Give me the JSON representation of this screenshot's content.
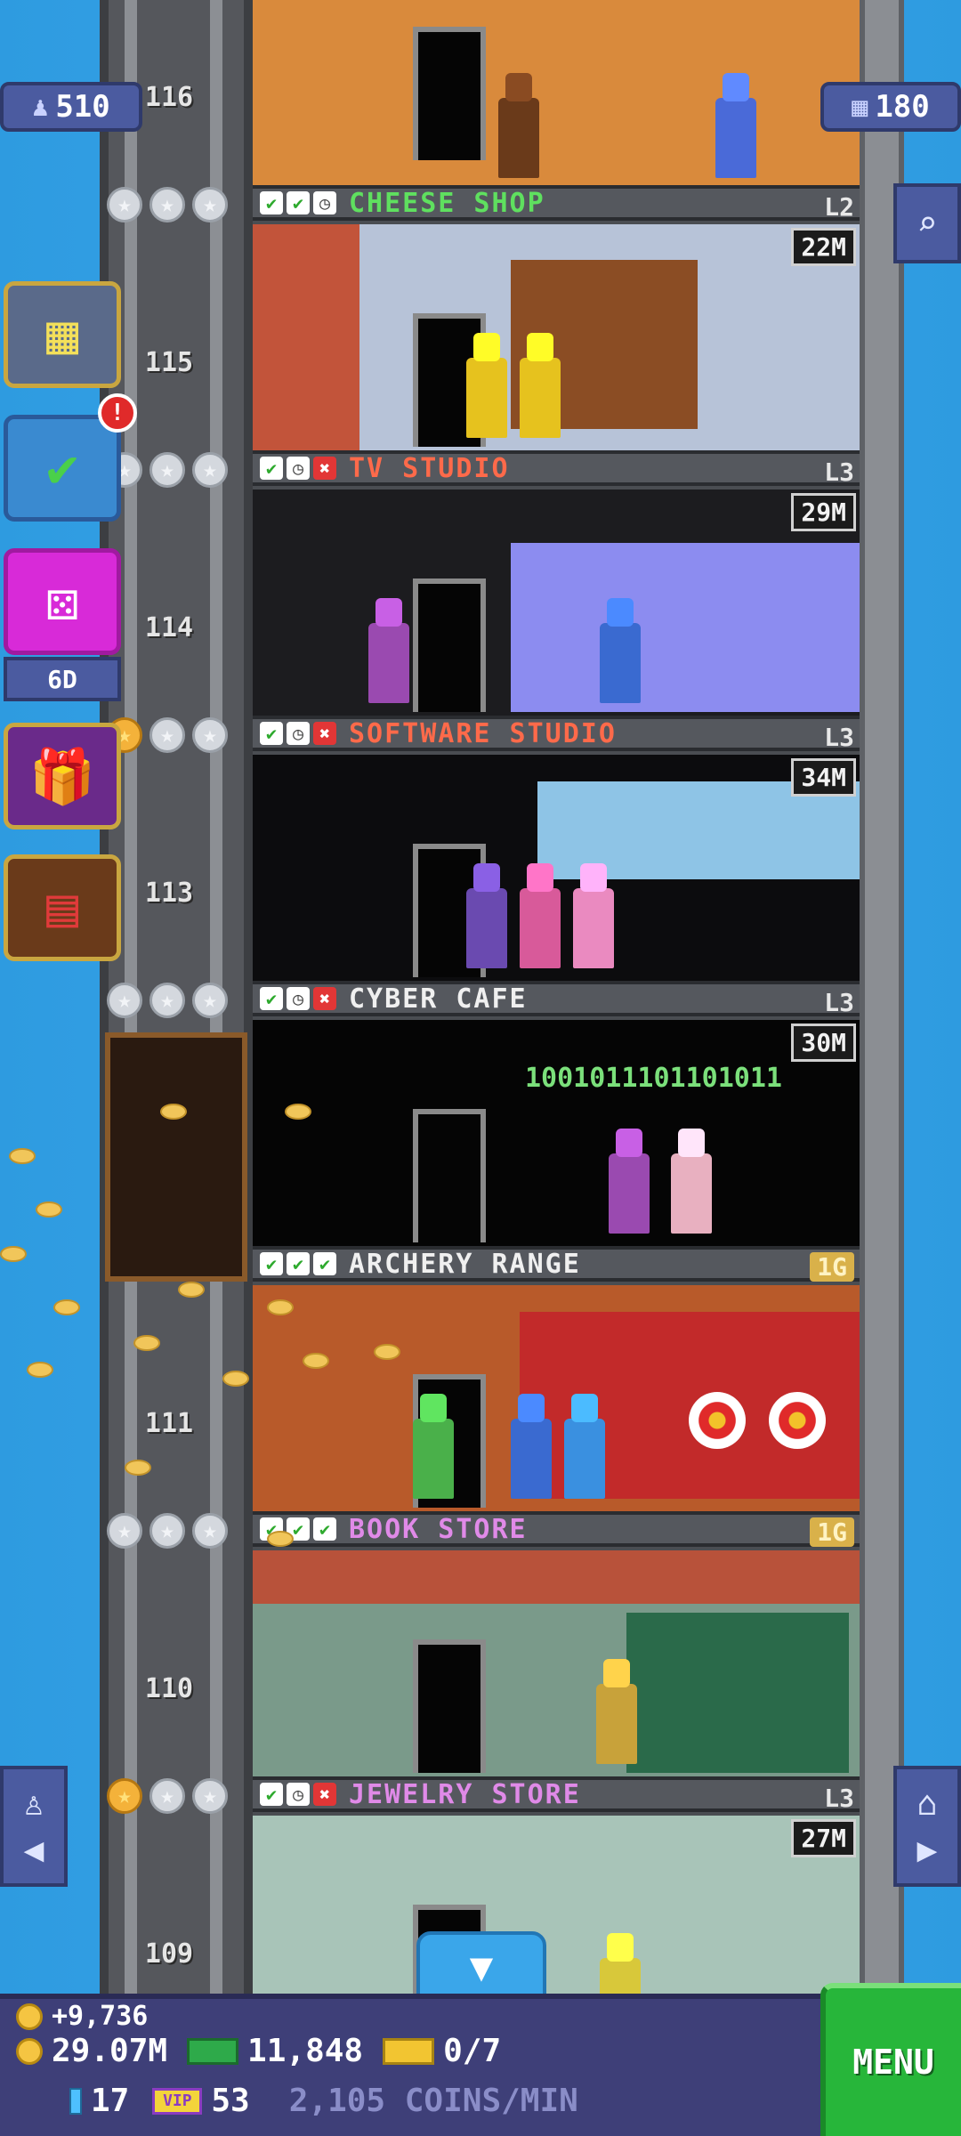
{
  "top_stats": {
    "population": "510",
    "floors_count": "180"
  },
  "side_buttons": {
    "dice_timer": "6D",
    "missions_badge": "!"
  },
  "shaft_floor_numbers": [
    "116",
    "115",
    "114",
    "113",
    "111",
    "110",
    "109"
  ],
  "floors": [
    {
      "name": "CHEESE SHOP",
      "level": "L2",
      "value": "22M",
      "name_color": "#5fe05f",
      "checks": [
        "check",
        "check",
        "clock"
      ]
    },
    {
      "name": "TV STUDIO",
      "level": "L3",
      "value": "29M",
      "name_color": "#ff6a4a",
      "checks": [
        "check",
        "clock",
        "x"
      ]
    },
    {
      "name": "SOFTWARE STUDIO",
      "level": "L3",
      "value": "34M",
      "name_color": "#ff6a4a",
      "checks": [
        "check",
        "clock",
        "x"
      ]
    },
    {
      "name": "CYBER CAFE",
      "level": "L3",
      "value": "30M",
      "name_color": "#f0f0f0",
      "checks": [
        "check",
        "clock",
        "x"
      ]
    },
    {
      "name": "ARCHERY RANGE",
      "level": "1G",
      "value": "",
      "name_color": "#f0f0f0",
      "checks": [
        "check",
        "check",
        "check"
      ]
    },
    {
      "name": "BOOK STORE",
      "level": "1G",
      "value": "",
      "name_color": "#e08ae8",
      "checks": [
        "check",
        "check",
        "check"
      ]
    },
    {
      "name": "JEWELRY STORE",
      "level": "L3",
      "value": "27M",
      "name_color": "#e08ae8",
      "checks": [
        "check",
        "clock",
        "x"
      ]
    }
  ],
  "cyber_cafe_binary": "1001011101101011",
  "hud": {
    "coins_gain": "+9,736",
    "coins_total": "29.07M",
    "bux": "11,848",
    "tickets": "0/7",
    "gems": "17",
    "vip": "53",
    "rate": "2,105 COINS/MIN",
    "menu_label": "MENU"
  },
  "icons": {
    "population": "person-icon",
    "floors": "building-icon",
    "search": "magnifier-icon",
    "elevator_rider": "elevator-person-icon",
    "home": "home-icon"
  }
}
